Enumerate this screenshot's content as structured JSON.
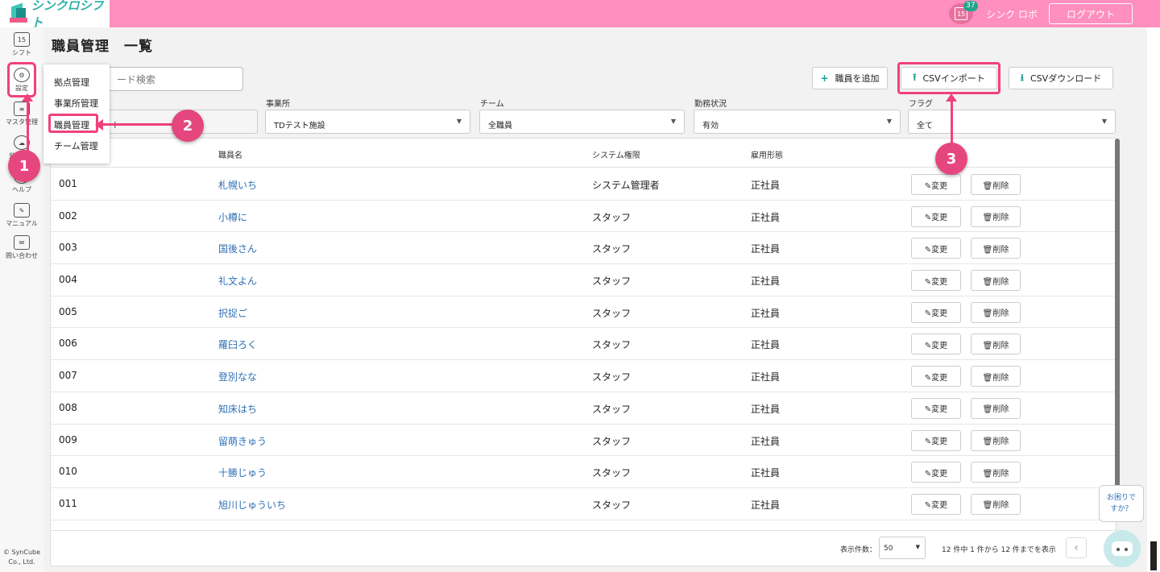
{
  "app": {
    "logo": "シンクロシフト",
    "calendar_day": "15",
    "calendar_badge": "37",
    "user_name": "シンク ロボ",
    "logout_label": "ログアウト"
  },
  "sidebar": {
    "items": [
      {
        "label": "シフト",
        "icon_text": "15"
      },
      {
        "label": "設定",
        "icon_text": "⚙"
      },
      {
        "label": "マスタ管理",
        "icon_text": "≡"
      },
      {
        "label": "外部連携",
        "icon_text": "☁"
      },
      {
        "label": "ヘルプ",
        "icon_text": "?"
      },
      {
        "label": "マニュアル",
        "icon_text": "✎"
      },
      {
        "label": "問い合わせ",
        "icon_text": "✉"
      }
    ],
    "copyright_line1": "© SynCube",
    "copyright_line2": "Co., Ltd."
  },
  "settings_menu": {
    "items": [
      "拠点管理",
      "事業所管理",
      "職員管理",
      "チーム管理"
    ]
  },
  "page": {
    "title": "職員管理　一覧",
    "search_placeholder": "ード検索",
    "add_button": "職員を追加",
    "import_button": "CSVインポート",
    "download_button": "CSVダウンロード",
    "add_icon": "+",
    "upload_icon": "⭱",
    "download_icon": "⭳"
  },
  "filters": {
    "first_value": "ト",
    "office": {
      "label": "事業所",
      "value": "TDテスト施設"
    },
    "team": {
      "label": "チーム",
      "value": "全職員"
    },
    "status": {
      "label": "勤務状況",
      "value": "有効"
    },
    "flag": {
      "label": "フラグ",
      "value": "全て"
    }
  },
  "table": {
    "headers": {
      "name": "職員名",
      "role": "システム権限",
      "employment": "雇用形態"
    },
    "edit_label": "✎変更",
    "delete_label": "🗑削除",
    "rows": [
      {
        "id": "001",
        "name": "札幌いち",
        "role": "システム管理者",
        "employment": "正社員"
      },
      {
        "id": "002",
        "name": "小樽に",
        "role": "スタッフ",
        "employment": "正社員"
      },
      {
        "id": "003",
        "name": "国後さん",
        "role": "スタッフ",
        "employment": "正社員"
      },
      {
        "id": "004",
        "name": "礼文よん",
        "role": "スタッフ",
        "employment": "正社員"
      },
      {
        "id": "005",
        "name": "択捉ご",
        "role": "スタッフ",
        "employment": "正社員"
      },
      {
        "id": "006",
        "name": "羅臼ろく",
        "role": "スタッフ",
        "employment": "正社員"
      },
      {
        "id": "007",
        "name": "登別なな",
        "role": "スタッフ",
        "employment": "正社員"
      },
      {
        "id": "008",
        "name": "知床はち",
        "role": "スタッフ",
        "employment": "正社員"
      },
      {
        "id": "009",
        "name": "留萌きゅう",
        "role": "スタッフ",
        "employment": "正社員"
      },
      {
        "id": "010",
        "name": "十勝じゅう",
        "role": "スタッフ",
        "employment": "正社員"
      },
      {
        "id": "011",
        "name": "旭川じゅういち",
        "role": "スタッフ",
        "employment": "正社員"
      }
    ],
    "footer": {
      "per_page_label": "表示件数：",
      "per_page_value": "50",
      "range_text": "12 件中 1 件から 12 件までを表示",
      "prev_icon": "‹"
    }
  },
  "callouts": {
    "one": "1",
    "two": "2",
    "three": "3"
  },
  "help": {
    "line1": "お困りで",
    "line2": "すか？"
  },
  "colors": {
    "topbar": "#ff8fbe",
    "accent": "#f0417b",
    "link": "#2f6fb5",
    "teal": "#1a9f9a"
  }
}
